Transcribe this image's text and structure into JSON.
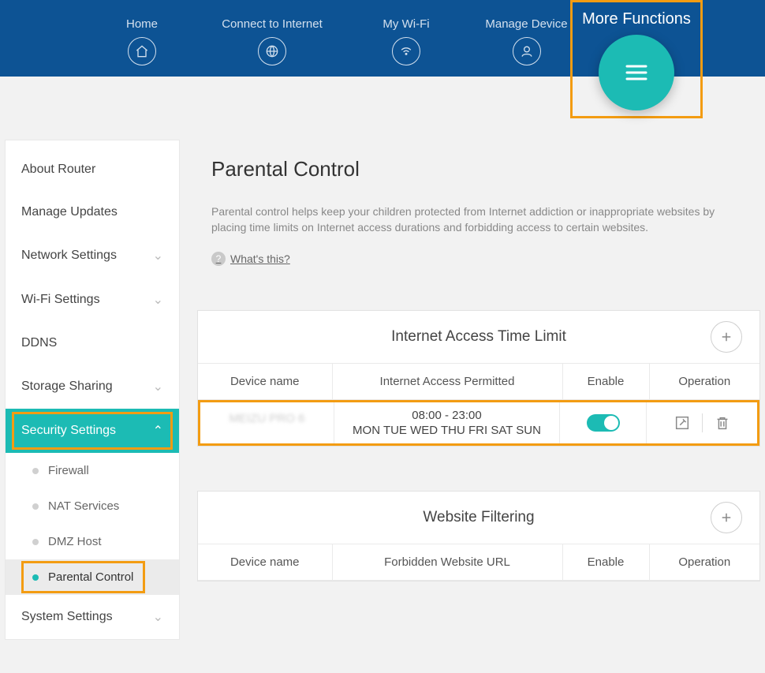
{
  "topnav": {
    "home": "Home",
    "connect": "Connect to Internet",
    "wifi": "My Wi-Fi",
    "manage": "Manage Device",
    "more": "More Functions"
  },
  "sidebar": {
    "about": "About Router",
    "updates": "Manage Updates",
    "network": "Network Settings",
    "wifi": "Wi-Fi Settings",
    "ddns": "DDNS",
    "storage": "Storage Sharing",
    "security": "Security Settings",
    "firewall": "Firewall",
    "nat": "NAT Services",
    "dmz": "DMZ Host",
    "parental": "Parental Control",
    "system": "System Settings"
  },
  "page": {
    "title": "Parental Control",
    "desc": "Parental control helps keep your children protected from Internet addiction or inappropriate websites by placing time limits on Internet access durations and forbidding access to certain websites.",
    "whats": "What's this?"
  },
  "timeLimit": {
    "title": "Internet Access Time Limit",
    "headers": {
      "device": "Device name",
      "permitted": "Internet Access Permitted",
      "enable": "Enable",
      "operation": "Operation"
    },
    "rows": [
      {
        "device": "MEIZU PRO 6",
        "time": "08:00 - 23:00",
        "days": "MON TUE WED THU FRI SAT SUN",
        "enabled": true
      }
    ]
  },
  "websiteFilter": {
    "title": "Website Filtering",
    "headers": {
      "device": "Device name",
      "url": "Forbidden Website URL",
      "enable": "Enable",
      "operation": "Operation"
    }
  },
  "colors": {
    "accent": "#1cbbb4",
    "highlight": "#f39c12",
    "topbar": "#0d5394"
  }
}
